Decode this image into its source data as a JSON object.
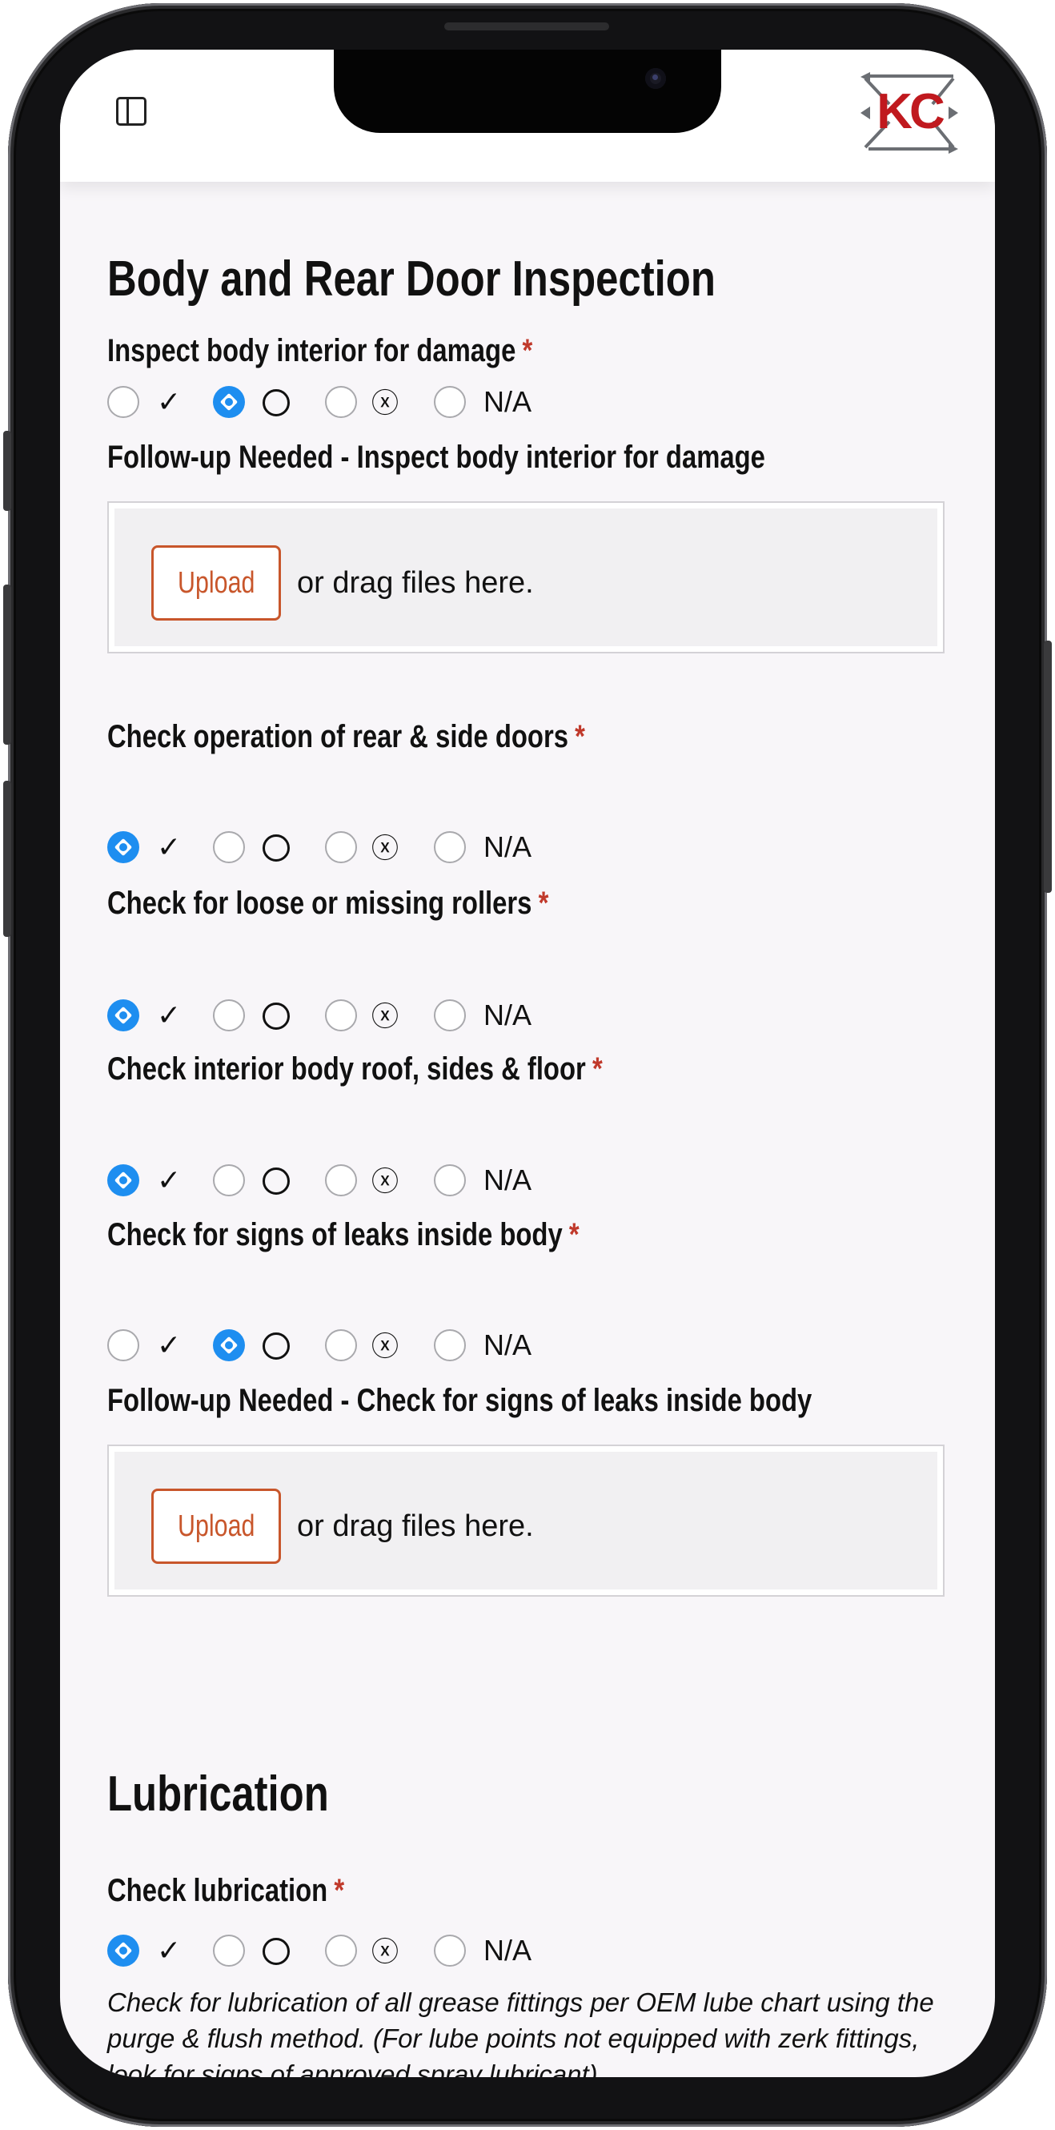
{
  "header": {
    "sidebar_toggle_icon": "sidebar-toggle-icon",
    "logo_letters": "KC",
    "logo_color": "#c0191e"
  },
  "sections": [
    {
      "title": "Body and Rear Door Inspection"
    },
    {
      "title": "Lubrication"
    }
  ],
  "option_labels": [
    "✓",
    "◯",
    "ⓧ",
    "N/A"
  ],
  "required_mark": "*",
  "questions": [
    {
      "label": "Inspect body interior for damage",
      "selected": 1
    },
    {
      "label": "Check operation of rear & side doors",
      "selected": 0
    },
    {
      "label": "Check for loose or missing rollers",
      "selected": 0
    },
    {
      "label": "Check interior body roof, sides & floor",
      "selected": 0
    },
    {
      "label": "Check for signs of leaks inside body",
      "selected": 1
    },
    {
      "label": "Check lubrication",
      "selected": 0
    }
  ],
  "followups": [
    {
      "label": "Follow-up Needed - Inspect body interior for damage",
      "upload_label": "Upload",
      "drag_text": "or drag files here."
    },
    {
      "label": "Follow-up Needed - Check for signs of leaks inside body",
      "upload_label": "Upload",
      "drag_text": "or drag files here."
    }
  ],
  "lubrication_help": "Check for lubrication of all grease fittings per OEM lube chart using the purge & flush method. (For lube points not equipped with zerk fittings, look for signs of approved spray lubricant).",
  "colors": {
    "accent_radio": "#1e8ef0",
    "required": "#c0392b",
    "upload_button": "#c8562b"
  }
}
